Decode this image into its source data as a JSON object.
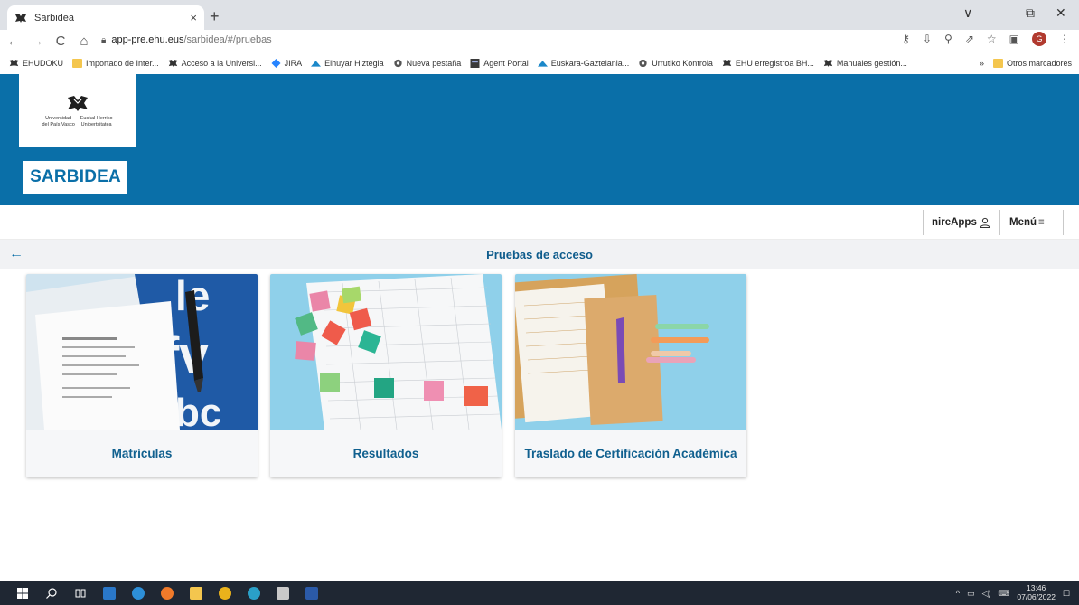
{
  "browser": {
    "tab_title": "Sarbidea",
    "tab_close": "×",
    "new_tab": "+",
    "window_controls": [
      "∨",
      "–",
      "⧉",
      "✕"
    ],
    "url_host": "app-pre.ehu.eus",
    "url_path": "/sarbidea/#/pruebas",
    "bookmarks": [
      {
        "label": "EHUDOKU",
        "icon": "ehu-icon"
      },
      {
        "label": "Importado de Inter...",
        "icon": "folder-icon"
      },
      {
        "label": "Acceso a la Universi...",
        "icon": "ehu-icon"
      },
      {
        "label": "JIRA",
        "icon": "jira-icon"
      },
      {
        "label": "Elhuyar Hiztegia",
        "icon": "elhuyar-icon"
      },
      {
        "label": "Nueva pestaña",
        "icon": "globe-icon"
      },
      {
        "label": "Agent Portal",
        "icon": "agent-icon"
      },
      {
        "label": "Euskara-Gaztelania...",
        "icon": "elhuyar-icon"
      },
      {
        "label": "Urrutiko Kontrola",
        "icon": "globe-icon"
      },
      {
        "label": "EHU erregistroa BH...",
        "icon": "ehu-icon"
      },
      {
        "label": "Manuales gestión...",
        "icon": "ehu-icon"
      }
    ],
    "bookmarks_more": "»",
    "other_bookmarks": "Otros marcadores",
    "profile_initial": "G"
  },
  "header": {
    "logo_left_text": "Universidad\ndel País Vasco",
    "logo_right_text": "Euskal Herriko\nUnibertsitatea",
    "brand": "SARBIDEA"
  },
  "appbar": {
    "apps_label": "nireApps",
    "menu_label": "Menú",
    "menu_icon": "≡"
  },
  "titlebar": {
    "back_icon": "←",
    "title": "Pruebas de acceso"
  },
  "cards": [
    {
      "label": "Matrículas"
    },
    {
      "label": "Resultados"
    },
    {
      "label": "Traslado de Certificación Académica"
    }
  ],
  "taskbar": {
    "time": "13:46",
    "date": "07/06/2022"
  }
}
